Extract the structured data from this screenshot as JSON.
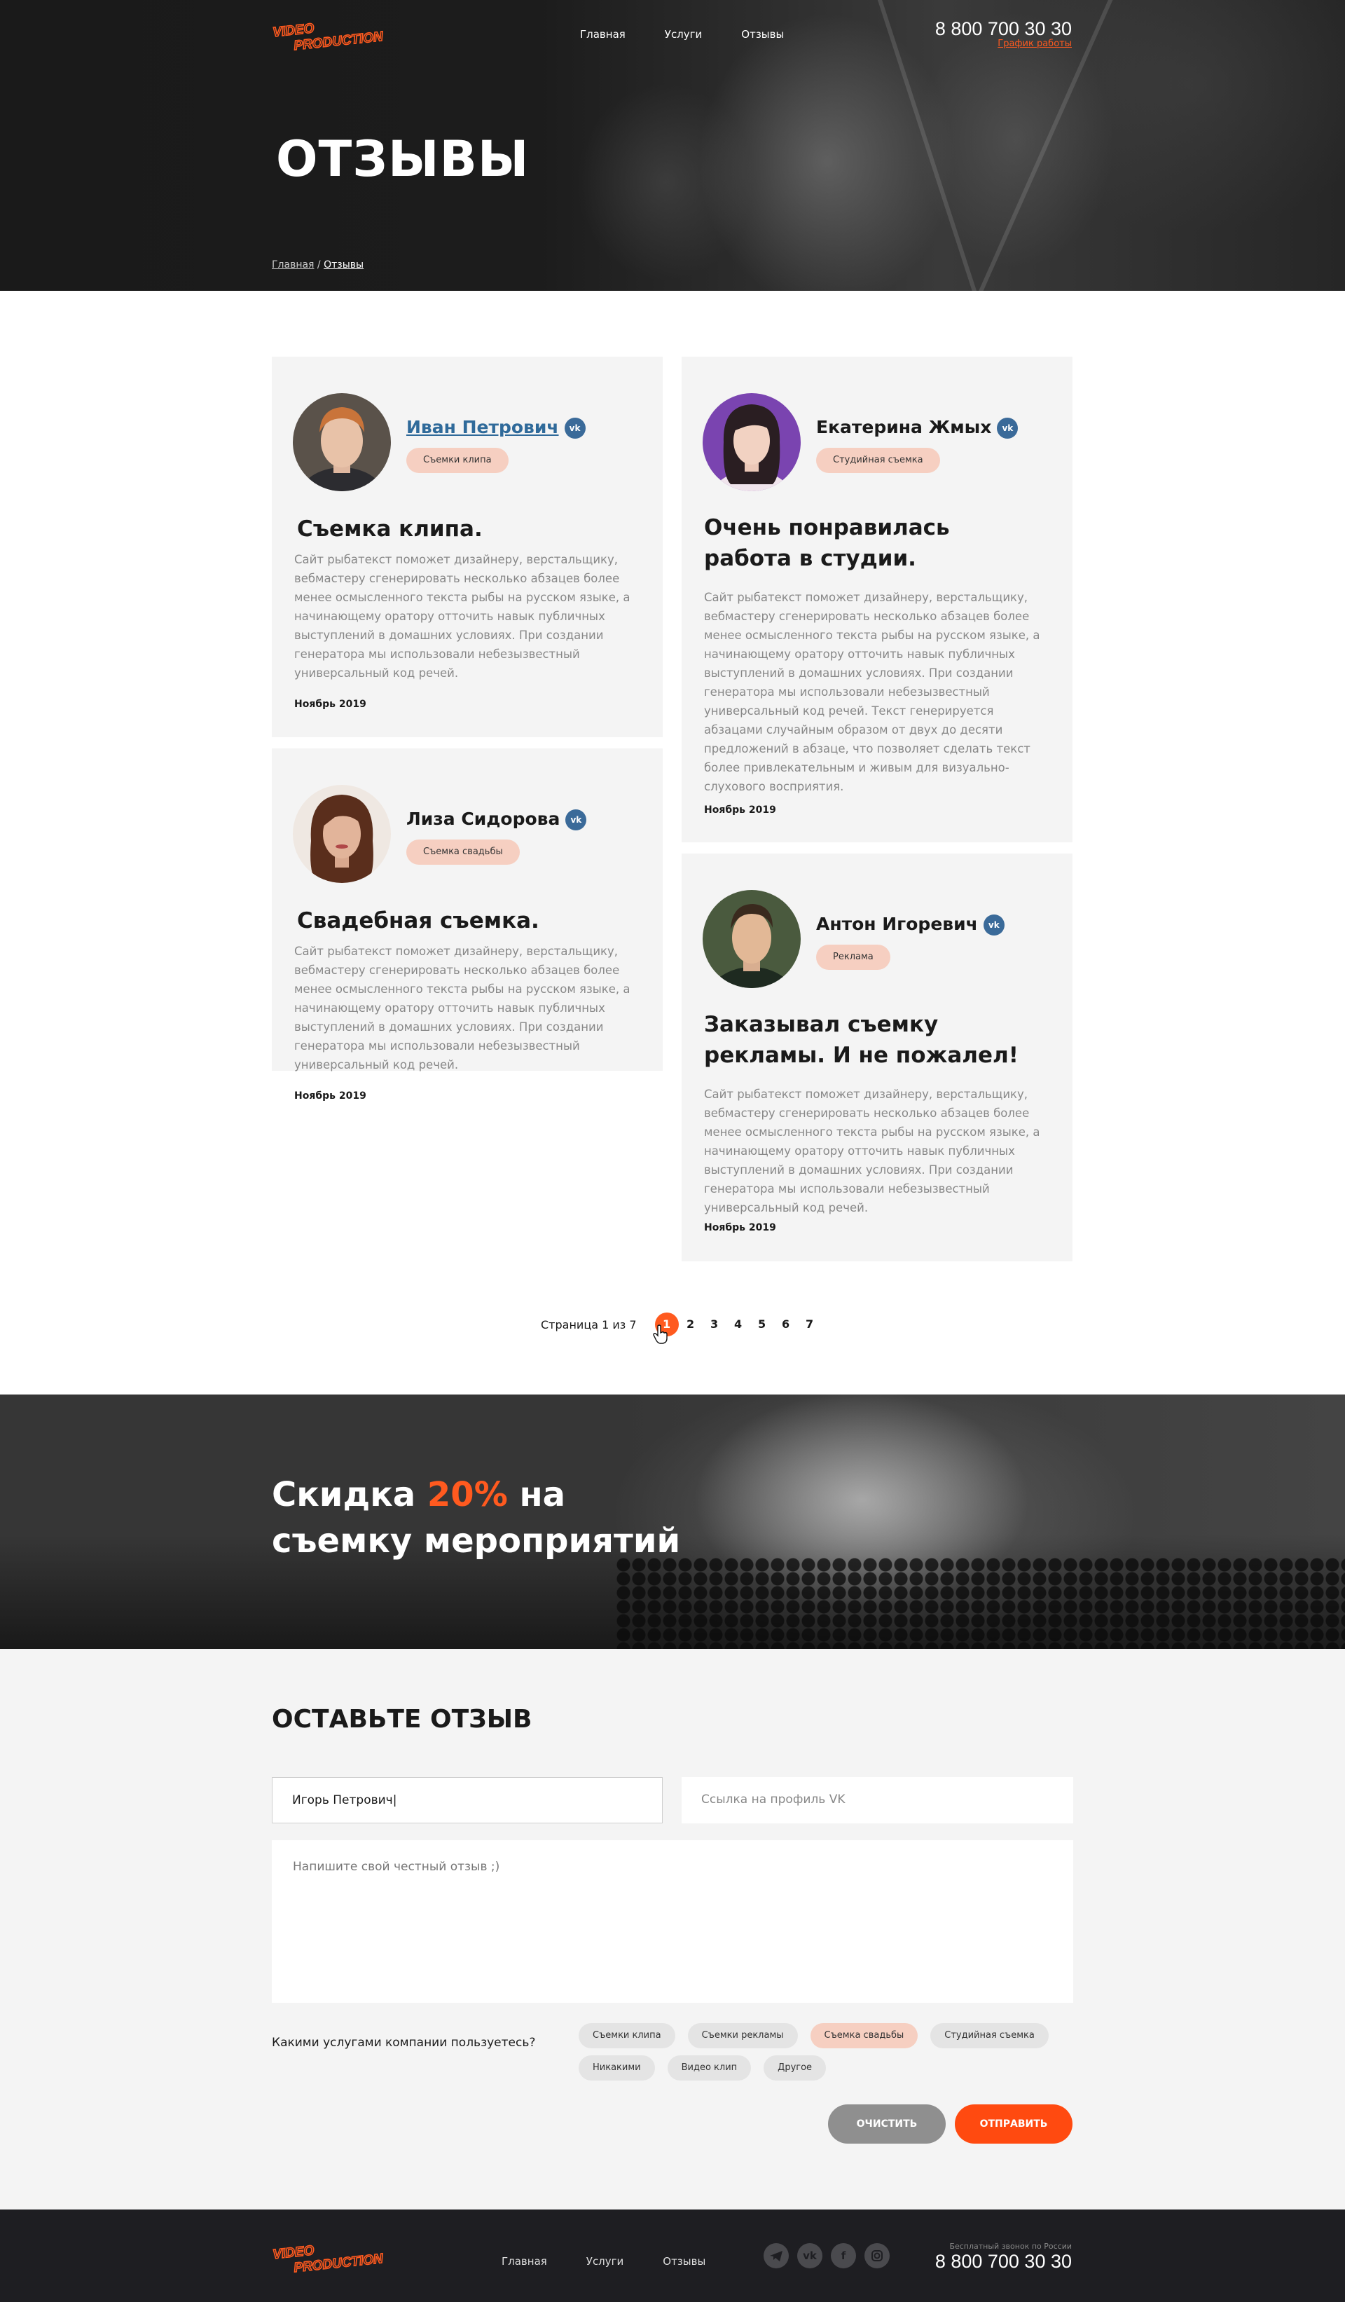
{
  "header": {
    "nav": [
      "Главная",
      "Услуги",
      "Отзывы"
    ],
    "phone": "8 800 700 30 30",
    "schedule_link": "График работы",
    "title": "ОТЗЫВЫ",
    "breadcrumb": {
      "home": "Главная",
      "separator": " / ",
      "current": "Отзывы"
    }
  },
  "reviews": [
    {
      "name": "Иван Петрович",
      "tag": "Съемки клипа",
      "title": "Съемка клипа.",
      "text": "Сайт рыбатекст поможет дизайнеру, верстальщику, вебмастеру сгенерировать несколько абзацев более менее осмысленного текста рыбы на русском языке, а начинающему оратору отточить навык публичных выступлений в домашних условиях. При создании генератора мы использовали небезызвестный универсальный код речей.",
      "date": "Ноябрь 2019"
    },
    {
      "name": "Екатерина Жмых",
      "tag": "Студийная съемка",
      "title": "Очень понравилась работа в студии.",
      "text": "Сайт рыбатекст поможет дизайнеру, верстальщику, вебмастеру сгенерировать несколько абзацев более менее осмысленного текста рыбы на русском языке, а начинающему оратору отточить навык публичных выступлений в домашних условиях. При создании генератора мы использовали небезызвестный универсальный код речей. Текст генерируется абзацами случайным образом от двух до десяти предложений в абзаце, что позволяет сделать текст более привлекательным и живым для визуально-слухового восприятия.",
      "date": "Ноябрь 2019"
    },
    {
      "name": "Лиза Сидорова",
      "tag": "Съемка свадьбы",
      "title": "Свадебная съемка.",
      "text": "Сайт рыбатекст поможет дизайнеру, верстальщику, вебмастеру сгенерировать несколько абзацев более менее осмысленного текста рыбы на русском языке, а начинающему оратору отточить навык публичных выступлений в домашних условиях. При создании генератора мы использовали небезызвестный универсальный код речей.",
      "date": "Ноябрь 2019"
    },
    {
      "name": "Антон Игоревич",
      "tag": "Реклама",
      "title": "Заказывал съемку рекламы. И не пожалел!",
      "text": "Сайт рыбатекст поможет дизайнеру, верстальщику, вебмастеру сгенерировать несколько абзацев более менее осмысленного текста рыбы на русском языке, а начинающему оратору отточить навык публичных выступлений в домашних условиях. При создании генератора мы использовали небезызвестный универсальный код речей.",
      "date": "Ноябрь 2019"
    }
  ],
  "vk_icon": "vk-icon",
  "pagination": {
    "label": "Страница 1 из 7",
    "pages": [
      "1",
      "2",
      "3",
      "4",
      "5",
      "6",
      "7"
    ],
    "active": "1"
  },
  "promo": {
    "line1_a": "Скидка ",
    "accent": "20%",
    "line1_b": " на",
    "line2": "съемку мероприятий"
  },
  "form": {
    "title": "ОСТАВЬТЕ ОТЗЫВ",
    "name_value": "Игорь Петрович|",
    "vk_placeholder": "Ссылка на профиль VK",
    "review_placeholder": "Напишите свой честный отзыв ;)",
    "question": "Какими услугами компании пользуетесь?",
    "chips": [
      "Съемки клипа",
      "Съемки рекламы",
      "Съемка свадьбы",
      "Студийная съемка",
      "Никакими",
      "Видео клип",
      "Другое"
    ],
    "selected_chip": "Съемка свадьбы",
    "clear_label": "ОЧИСТИТЬ",
    "send_label": "ОТПРАВИТЬ"
  },
  "footer": {
    "nav": [
      "Главная",
      "Услуги",
      "Отзывы"
    ],
    "social_icons": [
      "telegram-icon",
      "vk-icon",
      "facebook-icon",
      "instagram-icon"
    ],
    "caption": "Бесплатный звонок по России",
    "phone": "8 800 700 30 30"
  },
  "colors": {
    "accent": "#ff5a1f",
    "tag": "#f6cfc1",
    "card": "#f4f4f4",
    "vk": "#3a6a99"
  }
}
